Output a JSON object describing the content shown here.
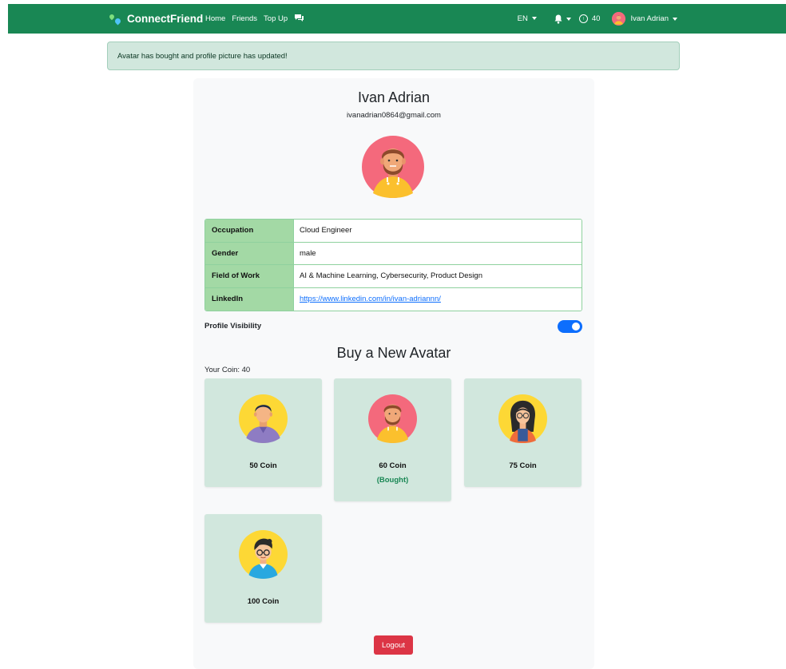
{
  "nav": {
    "brand": "ConnectFriend",
    "links": [
      "Home",
      "Friends",
      "Top Up"
    ],
    "chat_icon": "chat-icon",
    "language": "EN",
    "bell_icon": "bell-icon",
    "coins": "40",
    "user_name": "Ivan Adrian"
  },
  "alert": {
    "text": "Avatar has bought and profile picture has updated!"
  },
  "profile": {
    "name": "Ivan Adrian",
    "email": "ivanadrian0864@gmail.com",
    "rows": [
      {
        "label": "Occupation",
        "value": "Cloud Engineer"
      },
      {
        "label": "Gender",
        "value": "male"
      },
      {
        "label": "Field of Work",
        "value": "AI & Machine Learning, Cybersecurity, Product Design"
      },
      {
        "label": "LinkedIn",
        "value": "https://www.linkedin.com/in/ivan-adriannn/"
      }
    ],
    "visibility_label": "Profile Visibility",
    "visibility_on": true
  },
  "shop": {
    "title": "Buy a New Avatar",
    "your_coin": "Your Coin: 40",
    "avatars": [
      {
        "price": "50 Coin",
        "status": "",
        "icon": "avatar-man-purple-icon"
      },
      {
        "price": "60 Coin",
        "status": "(Bought)",
        "icon": "avatar-bearded-man-icon"
      },
      {
        "price": "75 Coin",
        "status": "",
        "icon": "avatar-woman-glasses-icon"
      },
      {
        "price": "100 Coin",
        "status": "",
        "icon": "avatar-boy-glasses-icon"
      }
    ]
  },
  "logout_label": "Logout",
  "colors": {
    "primary_green": "#198754",
    "alert_bg": "#d1e7dd",
    "table_key_bg": "#a3d9a5",
    "toggle_blue": "#0d6efd",
    "logout_red": "#dc3545"
  }
}
